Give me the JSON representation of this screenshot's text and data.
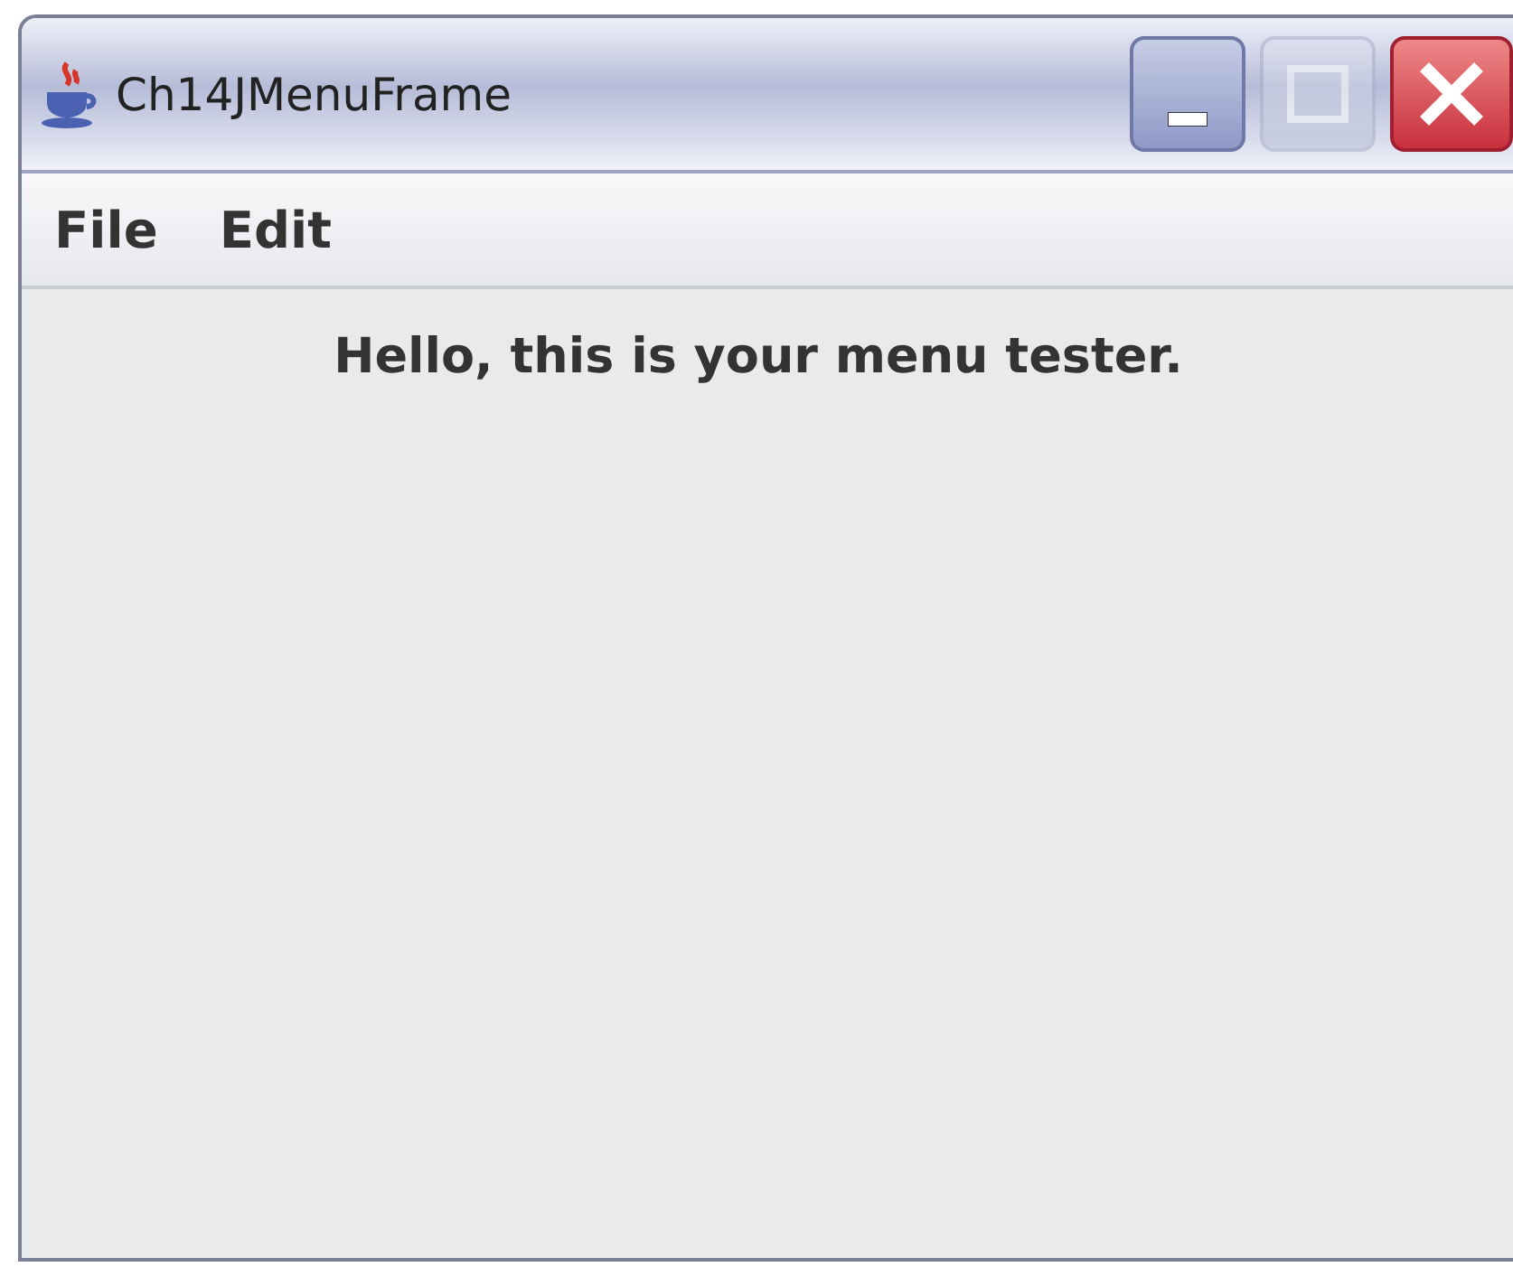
{
  "window": {
    "title": "Ch14JMenuFrame",
    "controls": [
      {
        "kind": "minimize",
        "disabled": false
      },
      {
        "kind": "maximize",
        "disabled": true
      },
      {
        "kind": "close",
        "disabled": false
      }
    ]
  },
  "menu_bar": {
    "items": [
      "File",
      "Edit"
    ]
  },
  "content": {
    "label": "Hello, this is your menu tester."
  }
}
